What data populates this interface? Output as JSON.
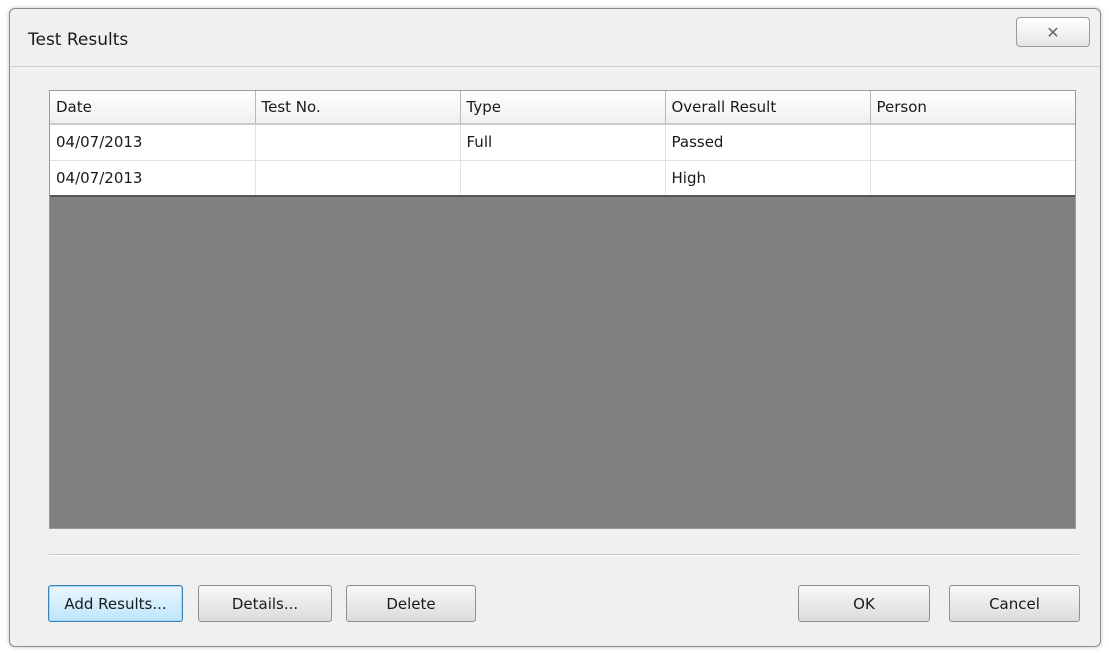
{
  "window": {
    "title": "Test Results",
    "close_glyph": "✕"
  },
  "grid": {
    "columns": [
      "Date",
      "Test No.",
      "Type",
      "Overall Result",
      "Person"
    ],
    "rows": [
      [
        "04/07/2013",
        "",
        "Full",
        "Passed",
        ""
      ],
      [
        "04/07/2013",
        "",
        "",
        "High",
        ""
      ]
    ],
    "empty_area_color": "#808080"
  },
  "buttons": {
    "add_results": "Add Results...",
    "details": "Details...",
    "delete": "Delete",
    "ok": "OK",
    "cancel": "Cancel"
  },
  "icons": {
    "close": "close-icon"
  }
}
